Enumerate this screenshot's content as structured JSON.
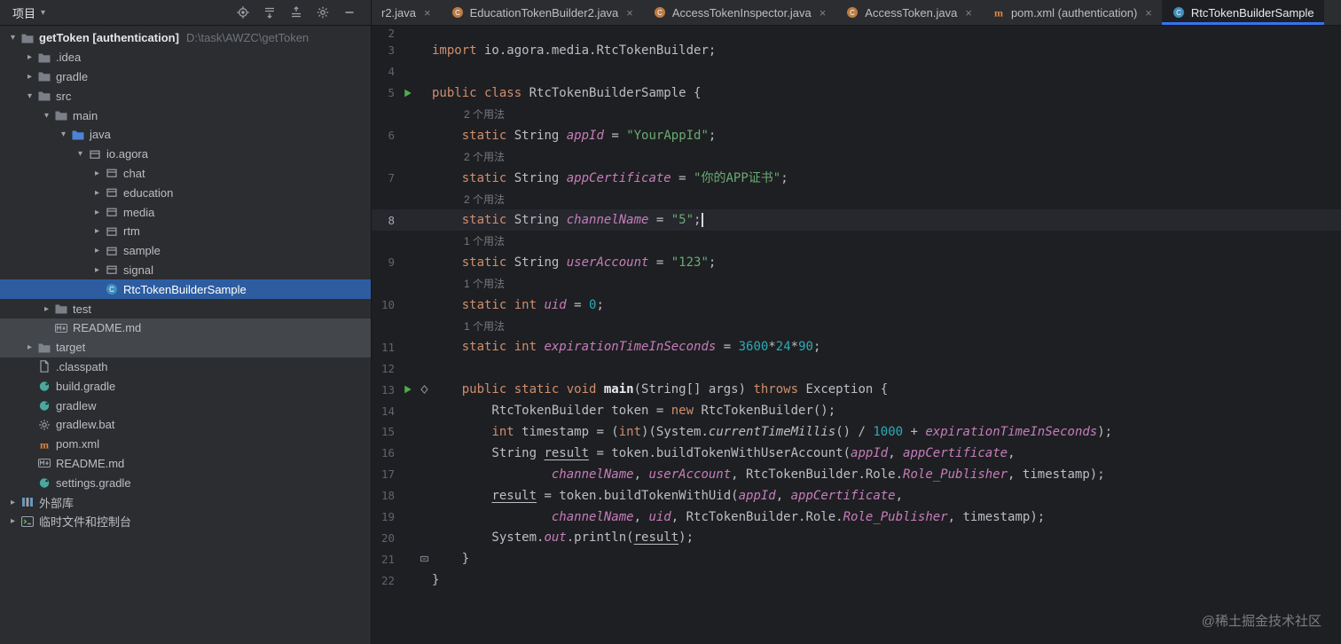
{
  "meta": {
    "watermark": "@稀土掘金技术社区"
  },
  "project_panel": {
    "header": {
      "title": "项目",
      "icons": [
        "locate",
        "expand-all",
        "collapse-all",
        "settings",
        "hide-panel"
      ]
    },
    "tree": [
      {
        "label": "getToken [authentication]",
        "secondary": "D:\\task\\AWZC\\getToken",
        "icon": "folder",
        "chevron": "expanded",
        "level": 0,
        "bold": true
      },
      {
        "label": ".idea",
        "icon": "folder",
        "chevron": "collapsed",
        "level": 1
      },
      {
        "label": "gradle",
        "icon": "folder",
        "chevron": "collapsed",
        "level": 1
      },
      {
        "label": "src",
        "icon": "folder",
        "chevron": "expanded",
        "level": 1
      },
      {
        "label": "main",
        "icon": "folder",
        "chevron": "expanded",
        "level": 2
      },
      {
        "label": "java",
        "icon": "folder-source",
        "chevron": "expanded",
        "level": 3
      },
      {
        "label": "io.agora",
        "icon": "package",
        "chevron": "expanded",
        "level": 4
      },
      {
        "label": "chat",
        "icon": "package",
        "chevron": "collapsed",
        "level": 5
      },
      {
        "label": "education",
        "icon": "package",
        "chevron": "collapsed",
        "level": 5
      },
      {
        "label": "media",
        "icon": "package",
        "chevron": "collapsed",
        "level": 5
      },
      {
        "label": "rtm",
        "icon": "package",
        "chevron": "collapsed",
        "level": 5
      },
      {
        "label": "sample",
        "icon": "package",
        "chevron": "collapsed",
        "level": 5
      },
      {
        "label": "signal",
        "icon": "package",
        "chevron": "collapsed",
        "level": 5
      },
      {
        "label": "RtcTokenBuilderSample",
        "icon": "class",
        "chevron": "none",
        "level": 5,
        "state": "selected"
      },
      {
        "label": "test",
        "icon": "folder",
        "chevron": "collapsed",
        "level": 2
      },
      {
        "label": "README.md",
        "icon": "markdown",
        "chevron": "none",
        "level": 2,
        "state": "highlighted"
      },
      {
        "label": "target",
        "icon": "folder",
        "chevron": "collapsed",
        "level": 1,
        "state": "highlighted"
      },
      {
        "label": ".classpath",
        "icon": "file",
        "chevron": "none",
        "level": 1
      },
      {
        "label": "build.gradle",
        "icon": "gradle",
        "chevron": "none",
        "level": 1
      },
      {
        "label": "gradlew",
        "icon": "gradle",
        "chevron": "none",
        "level": 1
      },
      {
        "label": "gradlew.bat",
        "icon": "gear-file",
        "chevron": "none",
        "level": 1
      },
      {
        "label": "pom.xml",
        "icon": "maven",
        "chevron": "none",
        "level": 1
      },
      {
        "label": "README.md",
        "icon": "markdown",
        "chevron": "none",
        "level": 1
      },
      {
        "label": "settings.gradle",
        "icon": "gradle",
        "chevron": "none",
        "level": 1
      },
      {
        "label": "外部库",
        "icon": "library",
        "chevron": "collapsed",
        "level": 0
      },
      {
        "label": "临时文件和控制台",
        "icon": "console",
        "chevron": "collapsed",
        "level": 0
      }
    ]
  },
  "tabs": [
    {
      "label": "r2.java",
      "icon": "none",
      "close": true
    },
    {
      "label": "EducationTokenBuilder2.java",
      "icon": "java-class",
      "close": true
    },
    {
      "label": "AccessTokenInspector.java",
      "icon": "java-class",
      "close": true
    },
    {
      "label": "AccessToken.java",
      "icon": "java-class",
      "close": true
    },
    {
      "label": "pom.xml (authentication)",
      "icon": "maven",
      "close": true
    },
    {
      "label": "RtcTokenBuilderSample",
      "icon": "class",
      "close": false,
      "selected": true
    }
  ],
  "editor": {
    "rows": [
      {
        "n": "2",
        "seg": []
      },
      {
        "n": "3",
        "seg": [
          [
            "k",
            "import"
          ],
          [
            "p",
            " io.agora.media.RtcTokenBuilder;"
          ]
        ]
      },
      {
        "n": "4",
        "seg": []
      },
      {
        "n": "5",
        "seg": [
          [
            "k",
            "public class"
          ],
          [
            "p",
            " RtcTokenBuilderSample {"
          ]
        ],
        "icons": [
          "run"
        ]
      },
      {
        "inlay": "2 个用法"
      },
      {
        "n": "6",
        "seg": [
          [
            "p",
            "    "
          ],
          [
            "k",
            "static"
          ],
          [
            "p",
            " String "
          ],
          [
            "f",
            "appId"
          ],
          [
            "p",
            " = "
          ],
          [
            "s",
            "\"YourAppId\""
          ],
          [
            "p",
            ";"
          ]
        ]
      },
      {
        "inlay": "2 个用法"
      },
      {
        "n": "7",
        "seg": [
          [
            "p",
            "    "
          ],
          [
            "k",
            "static"
          ],
          [
            "p",
            " String "
          ],
          [
            "f",
            "appCertificate"
          ],
          [
            "p",
            " = "
          ],
          [
            "s",
            "\"你的APP证书\""
          ],
          [
            "p",
            ";"
          ]
        ]
      },
      {
        "inlay": "2 个用法"
      },
      {
        "n": "8",
        "seg": [
          [
            "p",
            "    "
          ],
          [
            "k",
            "static"
          ],
          [
            "p",
            " String "
          ],
          [
            "f",
            "channelName"
          ],
          [
            "p",
            " = "
          ],
          [
            "s",
            "\"5\""
          ],
          [
            "p",
            ";"
          ]
        ],
        "current": true,
        "caret": true
      },
      {
        "inlay": "1 个用法"
      },
      {
        "n": "9",
        "seg": [
          [
            "p",
            "    "
          ],
          [
            "k",
            "static"
          ],
          [
            "p",
            " String "
          ],
          [
            "f",
            "userAccount"
          ],
          [
            "p",
            " = "
          ],
          [
            "s",
            "\"123\""
          ],
          [
            "p",
            ";"
          ]
        ]
      },
      {
        "inlay": "1 个用法"
      },
      {
        "n": "10",
        "seg": [
          [
            "p",
            "    "
          ],
          [
            "k",
            "static int"
          ],
          [
            "p",
            " "
          ],
          [
            "f",
            "uid"
          ],
          [
            "p",
            " = "
          ],
          [
            "num",
            "0"
          ],
          [
            "p",
            ";"
          ]
        ]
      },
      {
        "inlay": "1 个用法"
      },
      {
        "n": "11",
        "seg": [
          [
            "p",
            "    "
          ],
          [
            "k",
            "static int"
          ],
          [
            "p",
            " "
          ],
          [
            "f",
            "expirationTimeInSeconds"
          ],
          [
            "p",
            " = "
          ],
          [
            "num",
            "3600"
          ],
          [
            "p",
            "*"
          ],
          [
            "num",
            "24"
          ],
          [
            "p",
            "*"
          ],
          [
            "num",
            "90"
          ],
          [
            "p",
            ";"
          ]
        ]
      },
      {
        "n": "12",
        "seg": []
      },
      {
        "n": "13",
        "seg": [
          [
            "p",
            "    "
          ],
          [
            "k",
            "public static void"
          ],
          [
            "p",
            " "
          ],
          [
            "d",
            "main"
          ],
          [
            "p",
            "(String[] args) "
          ],
          [
            "k",
            "throws"
          ],
          [
            "p",
            " Exception {"
          ]
        ],
        "icons": [
          "run",
          "diamond"
        ]
      },
      {
        "n": "14",
        "seg": [
          [
            "p",
            "        RtcTokenBuilder token = "
          ],
          [
            "k",
            "new"
          ],
          [
            "p",
            " RtcTokenBuilder();"
          ]
        ]
      },
      {
        "n": "15",
        "seg": [
          [
            "p",
            "        "
          ],
          [
            "k",
            "int"
          ],
          [
            "p",
            " timestamp = ("
          ],
          [
            "k",
            "int"
          ],
          [
            "p",
            ")(System."
          ],
          [
            "m",
            "currentTimeMillis"
          ],
          [
            "p",
            "() / "
          ],
          [
            "num",
            "1000"
          ],
          [
            "p",
            " + "
          ],
          [
            "f",
            "expirationTimeInSeconds"
          ],
          [
            "p",
            ");"
          ]
        ]
      },
      {
        "n": "16",
        "seg": [
          [
            "p",
            "        String "
          ],
          [
            "u",
            "result"
          ],
          [
            "p",
            " = token.buildTokenWithUserAccount("
          ],
          [
            "f",
            "appId"
          ],
          [
            "p",
            ", "
          ],
          [
            "f",
            "appCertificate"
          ],
          [
            "p",
            ","
          ]
        ]
      },
      {
        "n": "17",
        "seg": [
          [
            "p",
            "                "
          ],
          [
            "f",
            "channelName"
          ],
          [
            "p",
            ", "
          ],
          [
            "f",
            "userAccount"
          ],
          [
            "p",
            ", RtcTokenBuilder.Role."
          ],
          [
            "f",
            "Role_Publisher"
          ],
          [
            "p",
            ", timestamp);"
          ]
        ]
      },
      {
        "n": "18",
        "seg": [
          [
            "p",
            "        "
          ],
          [
            "u",
            "result"
          ],
          [
            "p",
            " = token.buildTokenWithUid("
          ],
          [
            "f",
            "appId"
          ],
          [
            "p",
            ", "
          ],
          [
            "f",
            "appCertificate"
          ],
          [
            "p",
            ","
          ]
        ]
      },
      {
        "n": "19",
        "seg": [
          [
            "p",
            "                "
          ],
          [
            "f",
            "channelName"
          ],
          [
            "p",
            ", "
          ],
          [
            "f",
            "uid"
          ],
          [
            "p",
            ", RtcTokenBuilder.Role."
          ],
          [
            "f",
            "Role_Publisher"
          ],
          [
            "p",
            ", timestamp);"
          ]
        ]
      },
      {
        "n": "20",
        "seg": [
          [
            "p",
            "        System."
          ],
          [
            "f",
            "out"
          ],
          [
            "p",
            ".println("
          ],
          [
            "u",
            "result"
          ],
          [
            "p",
            ");"
          ]
        ]
      },
      {
        "n": "21",
        "seg": [
          [
            "p",
            "    }"
          ]
        ],
        "icons": [
          "fold"
        ]
      },
      {
        "n": "22",
        "seg": [
          [
            "p",
            "}"
          ]
        ]
      }
    ]
  }
}
